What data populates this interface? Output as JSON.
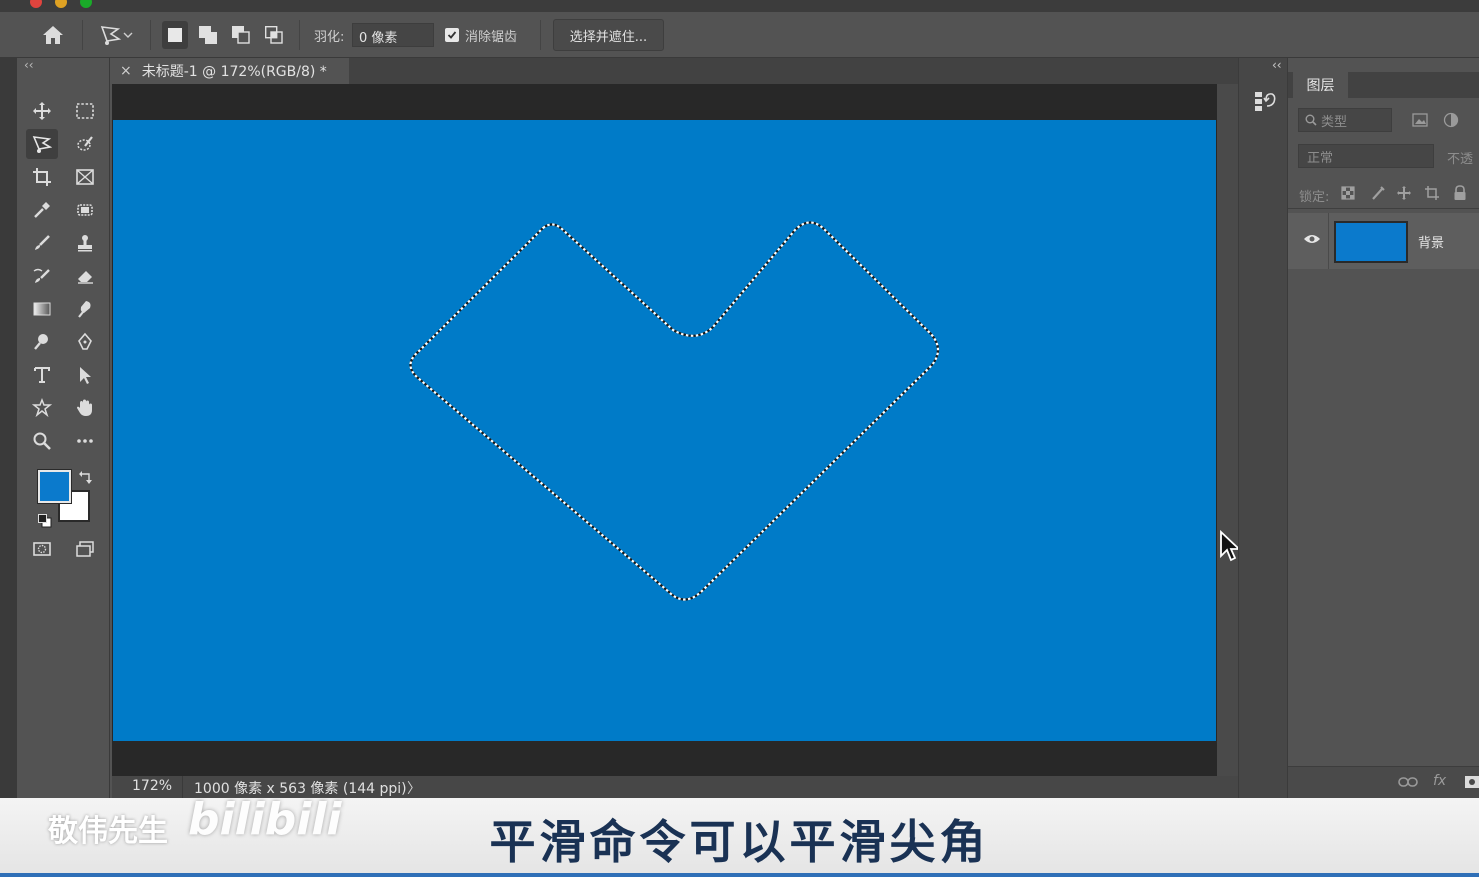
{
  "window": {
    "title_ghost": "敬伟先生"
  },
  "options_bar": {
    "feather_label": "羽化:",
    "feather_value": "0 像素",
    "antialias_label": "消除锯齿",
    "antialias_checked": true,
    "select_mask_label": "选择并遮住..."
  },
  "document": {
    "tab_close": "×",
    "tab_title": "未标题-1 @ 172%(RGB/8) *",
    "zoom": "172%",
    "info": "1000 像素 x 563 像素 (144 ppi)",
    "info_arrow": "〉",
    "canvas_color": "#007bc8"
  },
  "toolbar": {
    "collapse": "‹‹",
    "foreground_color": "#0b7acc",
    "background_color": "#ffffff"
  },
  "layers_panel": {
    "collapse": "‹‹",
    "tab_label": "图层",
    "filter_placeholder": "类型",
    "blend_mode": "正常",
    "opacity_label": "不透",
    "lock_label": "锁定:",
    "layers": [
      {
        "name": "背景",
        "visible": true,
        "thumb_color": "#0b7acc"
      }
    ]
  },
  "overlay": {
    "author": "敬伟先生",
    "logo": "bilibili",
    "subtitle": "平滑命令可以平滑尖角"
  }
}
